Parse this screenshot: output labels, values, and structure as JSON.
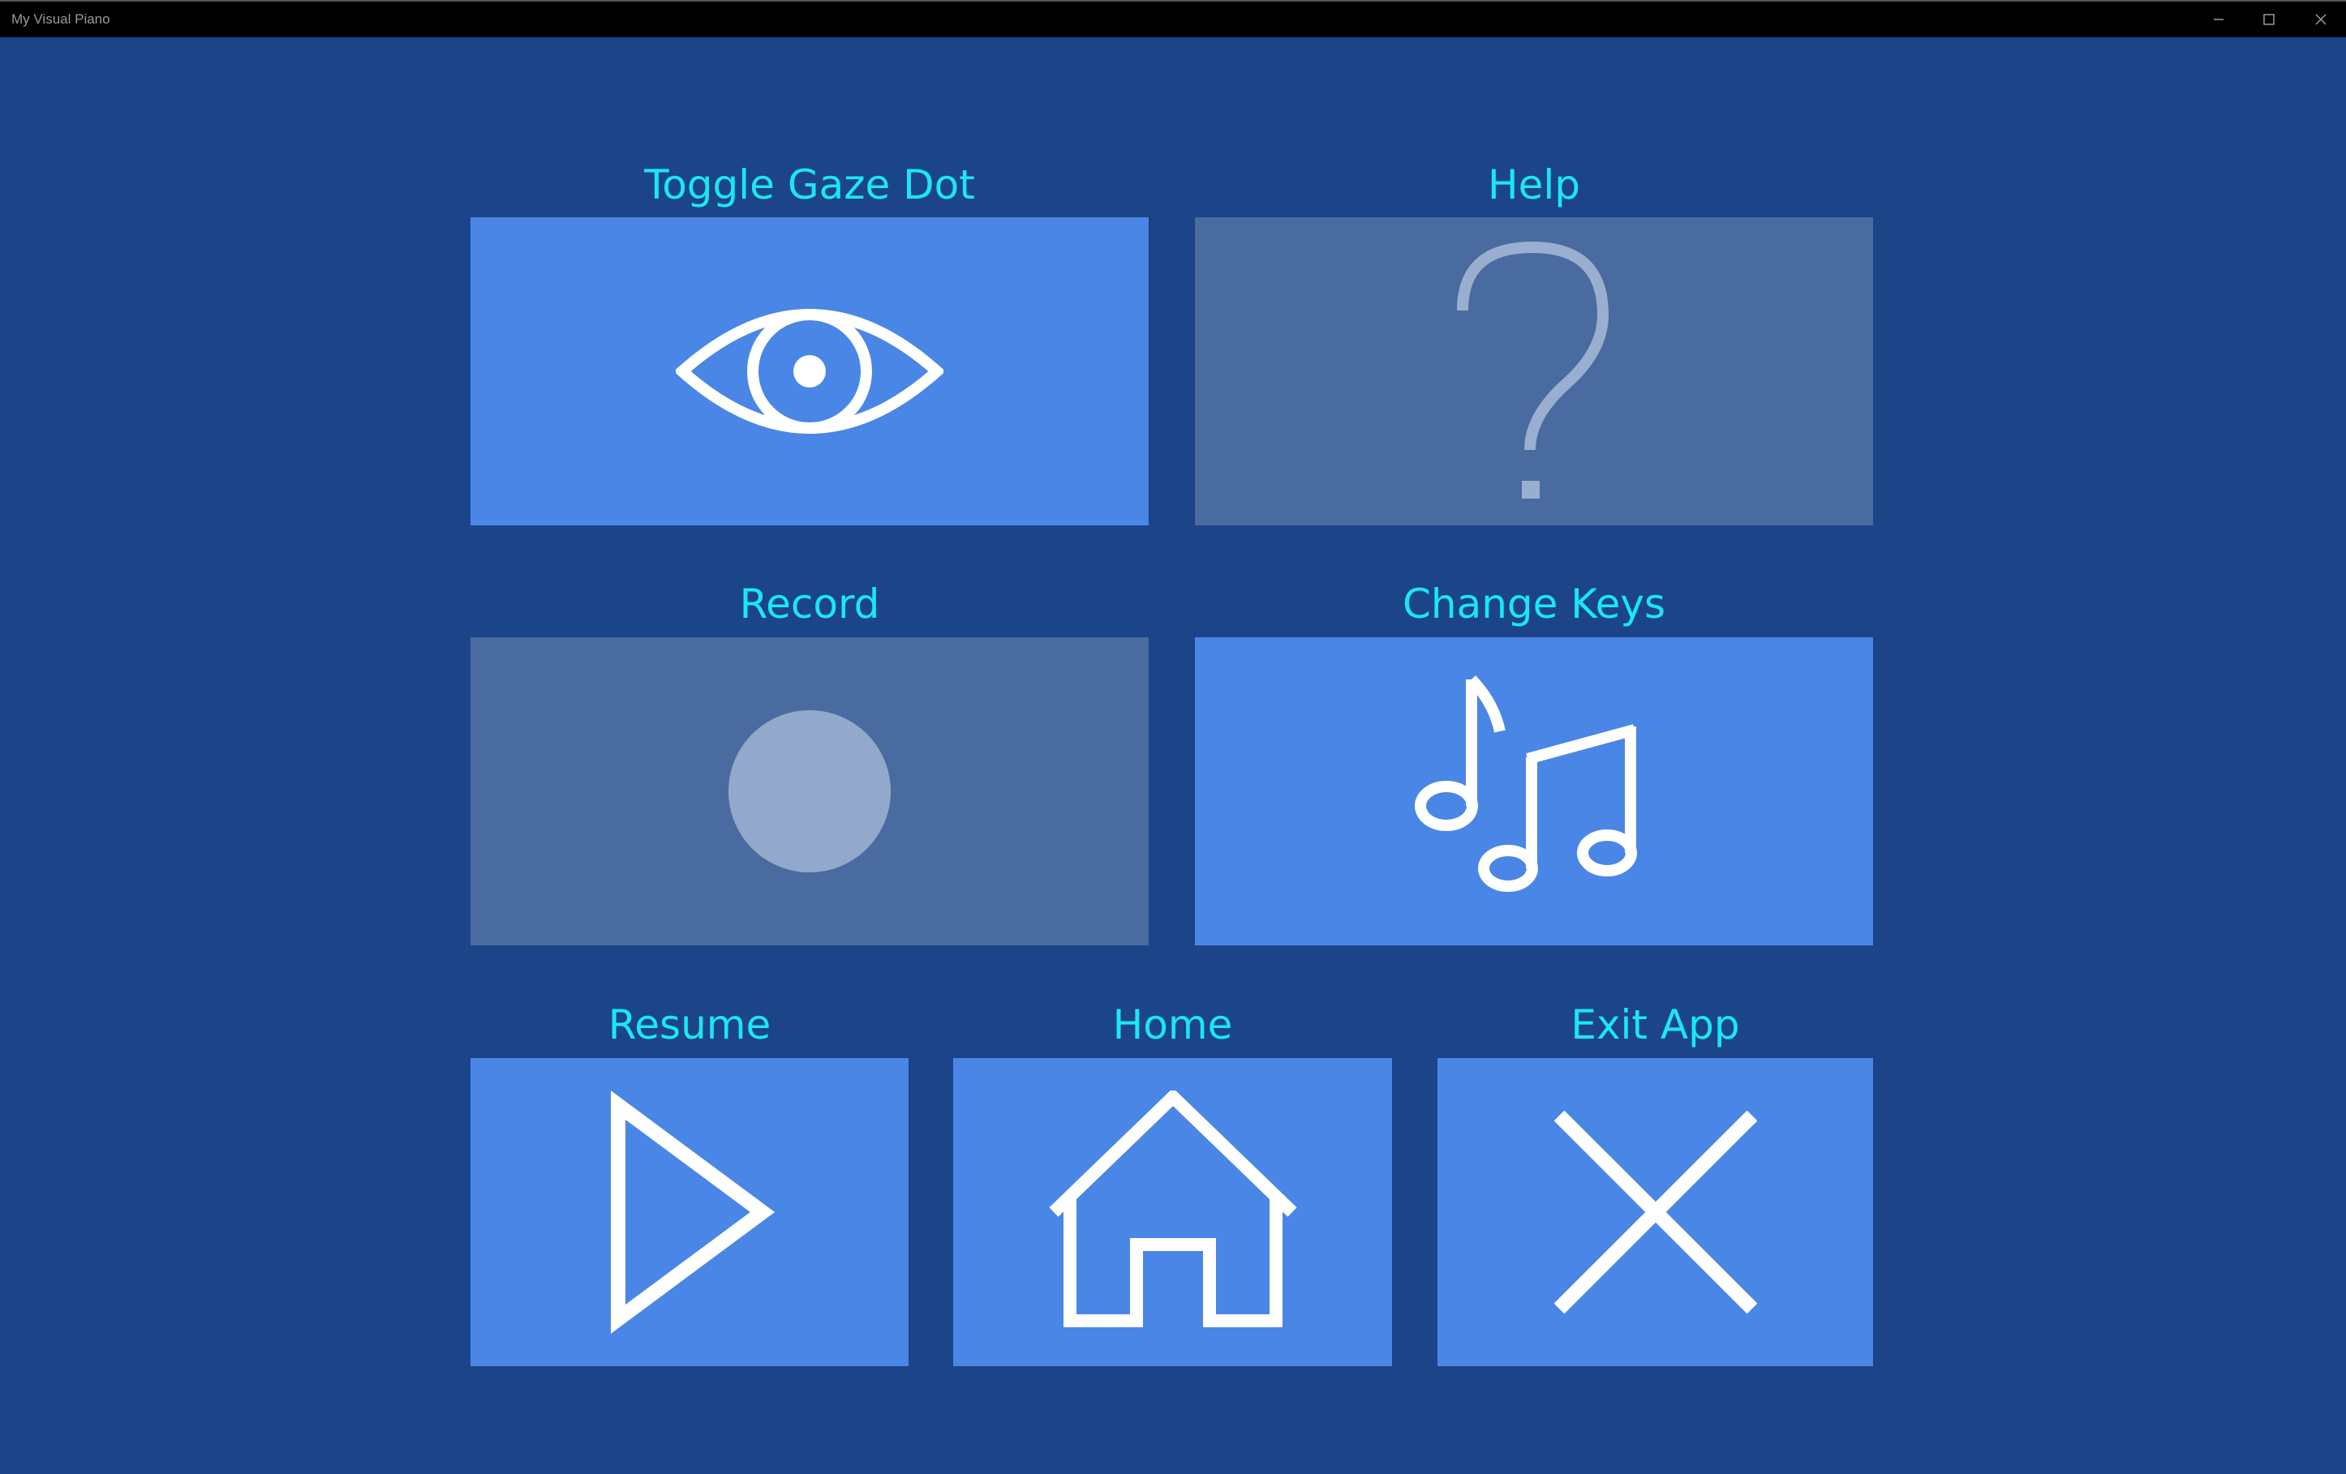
{
  "window": {
    "title": "My Visual Piano",
    "controls": {
      "minimize_icon": "minimize-icon",
      "maximize_icon": "maximize-icon",
      "close_icon": "close-icon"
    }
  },
  "colors": {
    "background": "#1c4488",
    "tile_active": "#4a86e6",
    "tile_disabled": "#4a6b9f",
    "label": "#19e7f4",
    "icon": "#ffffff",
    "icon_disabled": "#9aaed0"
  },
  "menu": {
    "toggle_gaze_dot": {
      "label": "Toggle Gaze Dot",
      "icon": "eye-icon",
      "enabled": true
    },
    "help": {
      "label": "Help",
      "icon": "question-mark-icon",
      "enabled": false
    },
    "record": {
      "label": "Record",
      "icon": "record-circle-icon",
      "enabled": false
    },
    "change_keys": {
      "label": "Change Keys",
      "icon": "music-notes-icon",
      "enabled": true
    },
    "resume": {
      "label": "Resume",
      "icon": "play-icon",
      "enabled": true
    },
    "home": {
      "label": "Home",
      "icon": "home-icon",
      "enabled": true
    },
    "exit_app": {
      "label": "Exit App",
      "icon": "close-icon",
      "enabled": true
    }
  }
}
